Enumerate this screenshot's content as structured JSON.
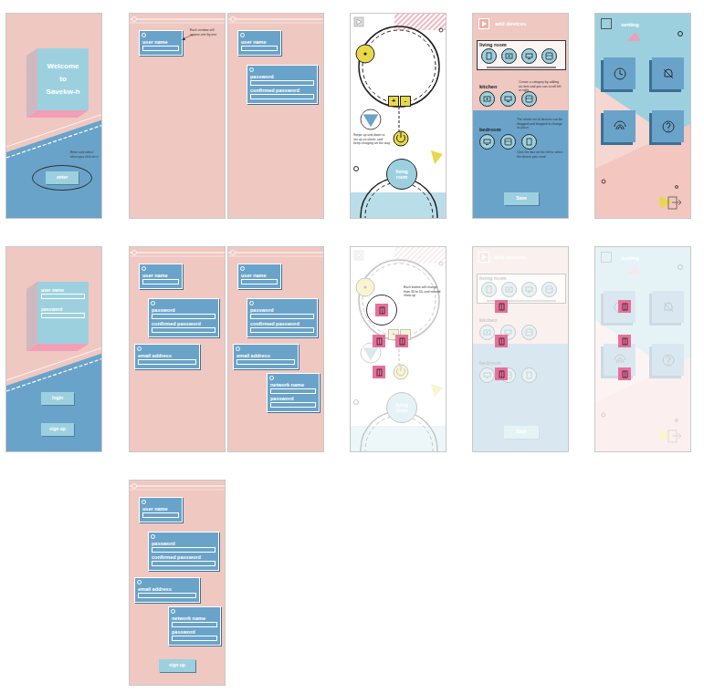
{
  "screens": [
    {
      "kind": "welcome",
      "dimmed": false,
      "title_lines": [
        "Welcome",
        "to",
        "Savekw-h"
      ],
      "note": "Enter and select when you click on it",
      "button": "enter"
    },
    {
      "kind": "form",
      "dimmed": false,
      "note": "Each window will appear one by one",
      "windows": [
        {
          "fields": [
            "user name"
          ]
        }
      ]
    },
    {
      "kind": "form",
      "dimmed": false,
      "windows": [
        {
          "fields": [
            "user name"
          ]
        },
        {
          "fields": [
            "password",
            "confirmed password"
          ]
        }
      ]
    },
    {
      "kind": "control",
      "dimmed": false,
      "note": "Swipe up and down to set up an alarm, and keep charging on the way",
      "plus": "+",
      "minus": "-",
      "room": "living room"
    },
    {
      "kind": "devices",
      "dimmed": false,
      "title": "add devices",
      "rooms": [
        "living room",
        "kitchen",
        "bedroom"
      ],
      "notes": [
        "Create a category by adding an item and you can scroll left or right",
        "The whole set of devices can be dragged and dropped to change its place",
        "Click the box on the left to select the device you need"
      ],
      "button": "Save"
    },
    {
      "kind": "setting",
      "dimmed": false,
      "title": "setting"
    },
    {
      "kind": "login",
      "dimmed": false,
      "fields": [
        "user name",
        "password"
      ],
      "buttons": [
        "login",
        "sign up"
      ]
    },
    {
      "kind": "form",
      "dimmed": false,
      "windows": [
        {
          "fields": [
            "user name"
          ]
        },
        {
          "fields": [
            "password",
            "confirmed password"
          ]
        },
        {
          "fields": [
            "email address"
          ]
        }
      ]
    },
    {
      "kind": "form",
      "dimmed": false,
      "windows": [
        {
          "fields": [
            "user name"
          ]
        },
        {
          "fields": [
            "password",
            "confirmed password"
          ]
        },
        {
          "fields": [
            "email address"
          ]
        },
        {
          "fields": [
            "network name",
            "password"
          ]
        }
      ]
    },
    {
      "kind": "control",
      "dimmed": true,
      "note": "Each button will change from 30 to 50, and rotated show up",
      "plus": "+",
      "minus": "-",
      "room": "living room"
    },
    {
      "kind": "devices",
      "dimmed": true,
      "title": "add devices",
      "rooms": [
        "living room",
        "kitchen",
        "bedroom"
      ],
      "notes": [],
      "button": "Save"
    },
    {
      "kind": "setting",
      "dimmed": true,
      "title": "setting"
    },
    {
      "kind": "form",
      "dimmed": false,
      "windows": [
        {
          "fields": [
            "user name"
          ]
        },
        {
          "fields": [
            "password",
            "confirmed password"
          ]
        },
        {
          "fields": [
            "email address"
          ]
        },
        {
          "fields": [
            "network name",
            "password"
          ]
        }
      ],
      "button": "sign up"
    }
  ]
}
